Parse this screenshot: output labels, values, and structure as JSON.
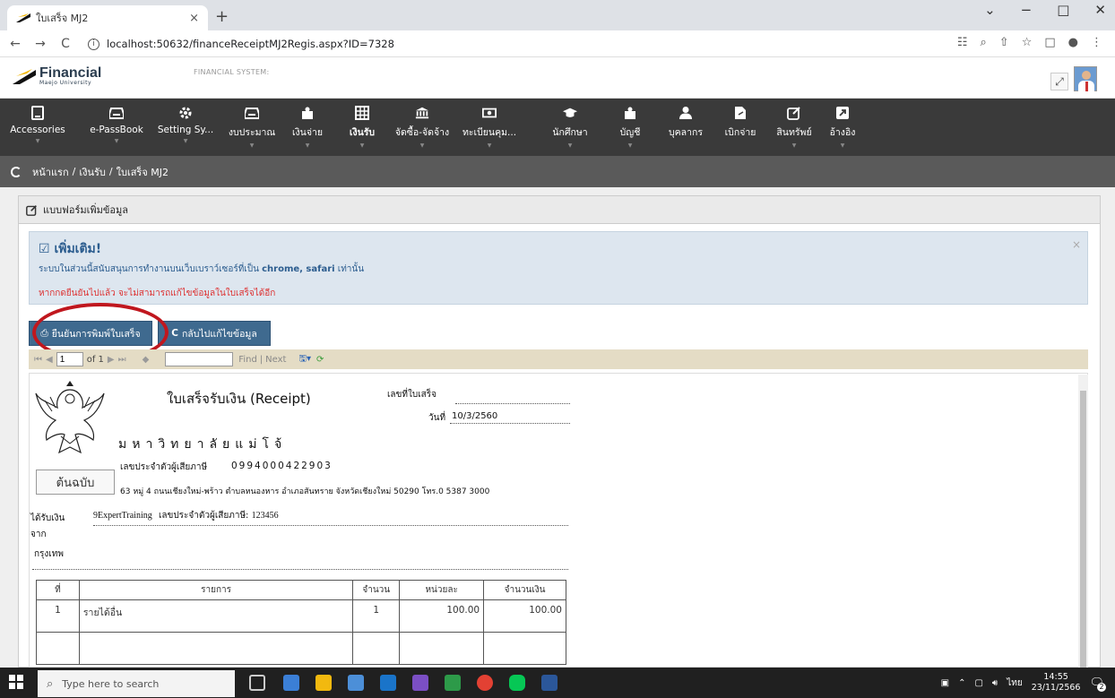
{
  "browser": {
    "tab_title": "ใบเสร็จ MJ2",
    "tab_close": "×",
    "new_tab": "+",
    "url": "localhost:50632/financeReceiptMJ2Regis.aspx?ID=7328",
    "back": "←",
    "forward": "→",
    "reload": "C",
    "window_controls": [
      "⌄",
      "−",
      "□",
      "✕"
    ]
  },
  "app": {
    "logo_text": "Financial",
    "logo_sub": "Maejo University",
    "system_name": "FINANCIAL SYSTEM:",
    "expand_icon": "⤢"
  },
  "menu": {
    "items": [
      {
        "label": "Accessories",
        "icon": "tablet-icon",
        "active": false
      },
      {
        "label": "e-PassBook",
        "icon": "inbox-icon",
        "active": false
      },
      {
        "label": "Setting Sy...",
        "icon": "gear-icon",
        "active": false
      },
      {
        "label": "งบประมาณ",
        "icon": "inbox-icon",
        "active": false
      },
      {
        "label": "เงินจ่าย",
        "icon": "puzzle-icon",
        "active": false
      },
      {
        "label": "เงินรับ",
        "icon": "table-icon",
        "active": true
      },
      {
        "label": "จัดซื้อ-จัดจ้าง",
        "icon": "bank-icon",
        "active": false
      },
      {
        "label": "ทะเบียนคุม...",
        "icon": "money-icon",
        "active": false
      },
      {
        "label": "นักศึกษา",
        "icon": "graduation-cap-icon",
        "active": false
      },
      {
        "label": "บัญชี",
        "icon": "puzzle-icon",
        "active": false
      },
      {
        "label": "บุคลากร",
        "icon": "user-icon",
        "active": false
      },
      {
        "label": "เบิกจ่าย",
        "icon": "share-file-icon",
        "active": false
      },
      {
        "label": "สินทรัพย์",
        "icon": "edit-icon",
        "active": false
      },
      {
        "label": "อ้างอิง",
        "icon": "external-link-icon",
        "active": false
      }
    ]
  },
  "breadcrumb": {
    "home": "หน้าแรก",
    "section": "เงินรับ",
    "current": "ใบเสร็จ MJ2",
    "sep": "/"
  },
  "panel": {
    "title": "แบบฟอร์มเพิ่มข้อมูล"
  },
  "alert": {
    "title": "เพิ่มเติม!",
    "line1_prefix": "ระบบในส่วนนี้สนับสนุนการทำงานบนเว็บเบราว์เซอร์ที่เป็น",
    "line1_bold": "chrome, safari",
    "line1_suffix": "เท่านั้น",
    "warning": "หากกดยืนยันไปแล้ว จะไม่สามารถแก้ไขข้อมูลในใบเสร็จได้อีก",
    "close": "×"
  },
  "buttons": {
    "confirm_print": "ยืนยันการพิมพ์ใบเสร็จ",
    "back_edit": "กลับไปแก้ไขข้อมูล"
  },
  "report_toolbar": {
    "page_value": "1",
    "of_pages": "of 1",
    "find_label": "Find",
    "next_label": "Next",
    "sep": "|"
  },
  "receipt": {
    "title": "ใบเสร็จรับเงิน (Receipt)",
    "receipt_no_label": "เลขที่ใบเสร็จ",
    "date_label": "วันที่",
    "date_value": "10/3/2560",
    "university": "มหาวิทยาลัยแม่โจ้",
    "tax_label": "เลขประจำตัวผู้เสียภาษี",
    "tax_value": "0994000422903",
    "copy_label": "ต้นฉบับ",
    "address": "63  หมู่ 4 ถนนเชียงใหม่-พร้าว ตำบลหนองหาร อำเภอสันทราย จังหวัดเชียงใหม่ 50290 โทร.0 5387 3000",
    "received_from_label": "ได้รับเงินจาก",
    "received_from_value": "9ExpertTraining",
    "payer_tax_label": "เลขประจำตัวผู้เสียภาษี:",
    "payer_tax_value": "123456",
    "payer_address": "กรุงเทพ",
    "table": {
      "headers": [
        "ที่",
        "รายการ",
        "จำนวน",
        "หน่วยละ",
        "จำนวนเงิน"
      ],
      "rows": [
        [
          "1",
          "รายได้อื่น",
          "1",
          "100.00",
          "100.00"
        ]
      ]
    }
  },
  "taskbar": {
    "search_placeholder": "Type here to search",
    "lang": "ไทย",
    "time": "14:55",
    "date": "23/11/2566",
    "notif_count": "2"
  }
}
